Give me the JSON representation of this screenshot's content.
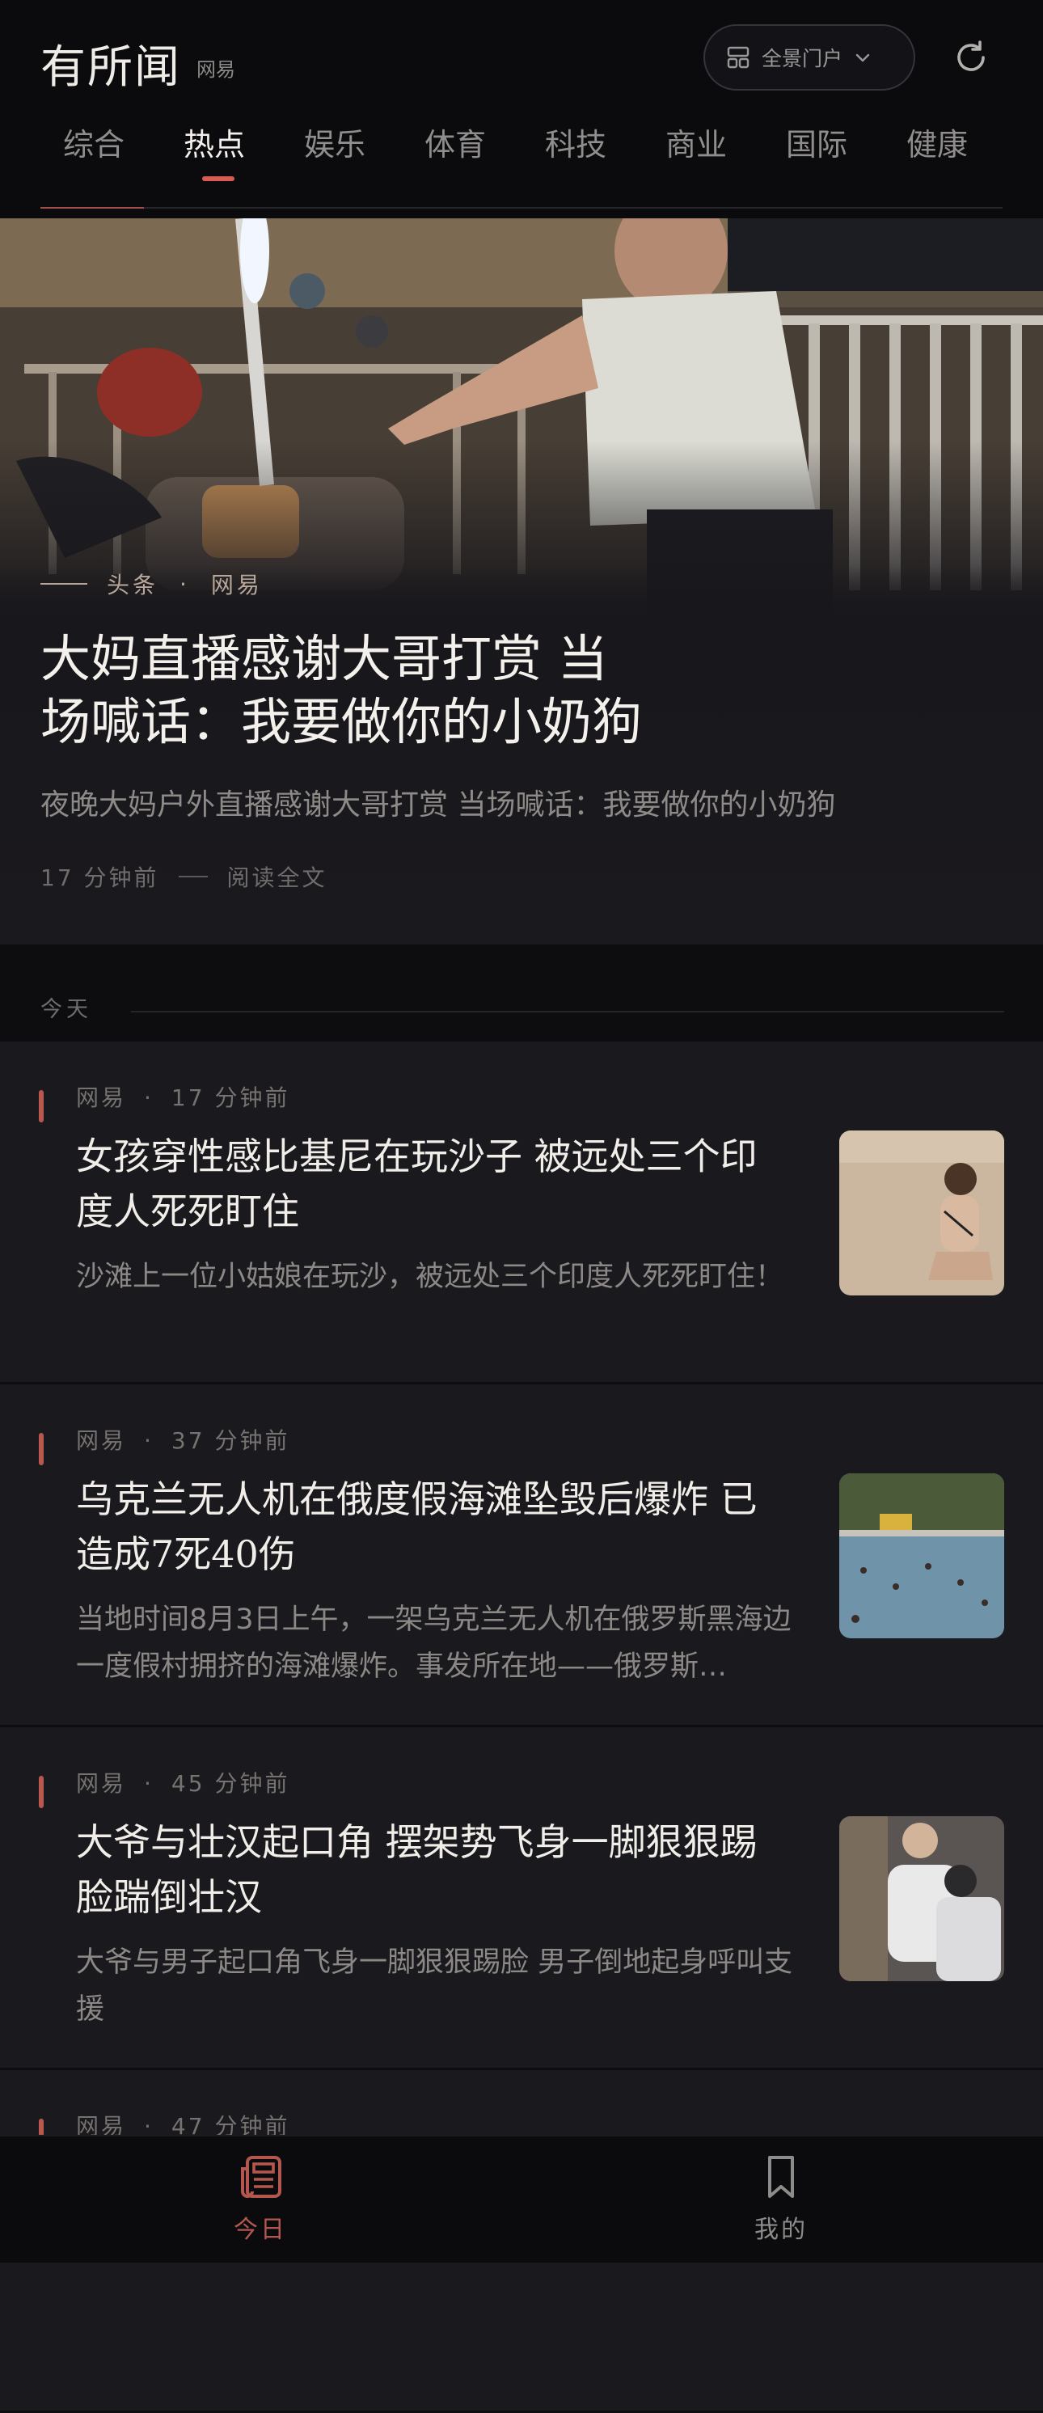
{
  "header": {
    "brand": "有所闻",
    "brand_sub": "网易",
    "portal_label": "全景门户"
  },
  "tabs": [
    {
      "label": "综合"
    },
    {
      "label": "热点"
    },
    {
      "label": "娱乐"
    },
    {
      "label": "体育"
    },
    {
      "label": "科技"
    },
    {
      "label": "商业"
    },
    {
      "label": "国际"
    },
    {
      "label": "健康"
    }
  ],
  "active_tab": "热点",
  "hero": {
    "tag": "头条",
    "source": "网易",
    "title_line1": "大妈直播感谢大哥打赏 当",
    "title_line2": "场喊话：我要做你的小奶狗",
    "summary": "夜晚大妈户外直播感谢大哥打赏 当场喊话：我要做你的小奶狗",
    "time": "17 分钟前",
    "read_more": "阅读全文"
  },
  "today_label": "今天",
  "news": [
    {
      "source": "网易",
      "time": "17 分钟前",
      "title": "女孩穿性感比基尼在玩沙子 被远处三个印度人死死盯住",
      "summary": "沙滩上一位小姑娘在玩沙，被远处三个印度人死死盯住！"
    },
    {
      "source": "网易",
      "time": "37 分钟前",
      "title": "乌克兰无人机在俄度假海滩坠毁后爆炸 已造成7死40伤",
      "summary": "当地时间8月3日上午，一架乌克兰无人机在俄罗斯黑海边一度假村拥挤的海滩爆炸。事发所在地——俄罗斯…"
    },
    {
      "source": "网易",
      "time": "45 分钟前",
      "title": "大爷与壮汉起口角 摆架势飞身一脚狠狠踢脸踹倒壮汉",
      "summary": "大爷与男子起口角飞身一脚狠狠踢脸 男子倒地起身呼叫支援"
    },
    {
      "source": "网易",
      "time": "47 分钟前",
      "title": "",
      "summary": ""
    }
  ],
  "bottom_nav": {
    "today": "今日",
    "mine": "我的"
  },
  "colors": {
    "accent": "#d95c52",
    "background": "#0d0d10",
    "card": "#1a191d"
  }
}
